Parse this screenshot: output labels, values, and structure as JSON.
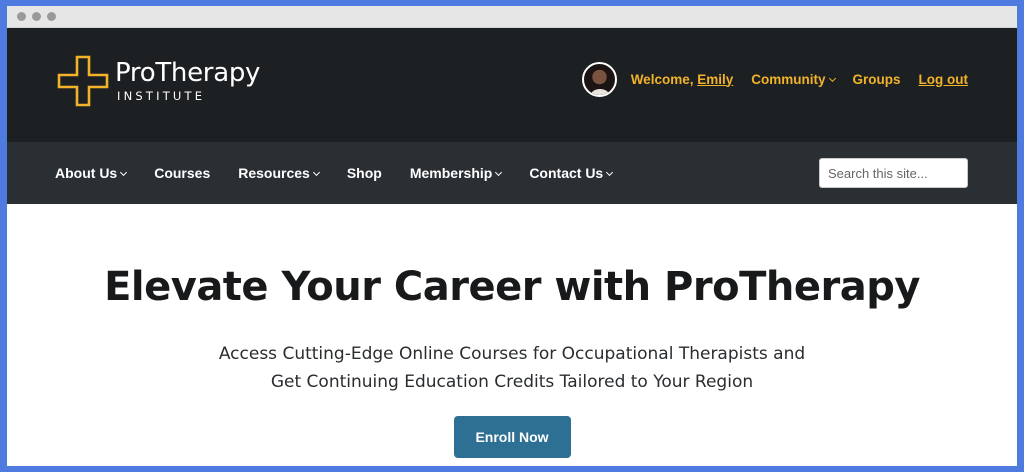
{
  "window": {
    "dots": [
      "close",
      "minimize",
      "maximize"
    ]
  },
  "header": {
    "logo": {
      "main": "ProTherapy",
      "sub": "INSTITUTE",
      "icon": "cross-outline-icon",
      "accent_color": "#f2b229"
    },
    "user_nav": {
      "welcome_prefix": "Welcome, ",
      "user_name": "Emily",
      "community": "Community",
      "groups": "Groups",
      "logout": "Log out",
      "link_color": "#f2b229"
    }
  },
  "nav": {
    "items": [
      {
        "label": "About Us",
        "dropdown": true
      },
      {
        "label": "Courses",
        "dropdown": false
      },
      {
        "label": "Resources",
        "dropdown": true
      },
      {
        "label": "Shop",
        "dropdown": false
      },
      {
        "label": "Membership",
        "dropdown": true
      },
      {
        "label": "Contact Us",
        "dropdown": true
      }
    ],
    "search_placeholder": "Search this site..."
  },
  "hero": {
    "title": "Elevate Your Career with ProTherapy",
    "subtitle_line1": "Access Cutting-Edge Online Courses for Occupational Therapists and",
    "subtitle_line2": "Get Continuing Education Credits Tailored to Your Region",
    "cta": "Enroll Now",
    "cta_color": "#2e6f94"
  }
}
